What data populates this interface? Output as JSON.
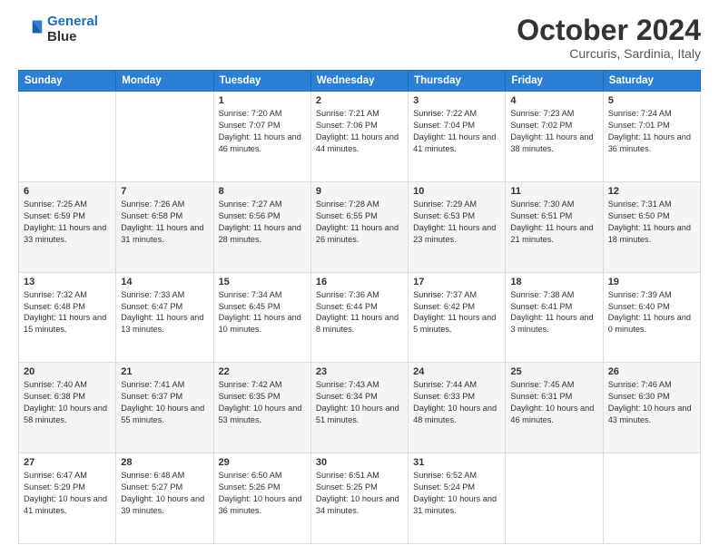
{
  "logo": {
    "line1": "General",
    "line2": "Blue"
  },
  "title": "October 2024",
  "subtitle": "Curcuris, Sardinia, Italy",
  "weekdays": [
    "Sunday",
    "Monday",
    "Tuesday",
    "Wednesday",
    "Thursday",
    "Friday",
    "Saturday"
  ],
  "weeks": [
    [
      {
        "day": "",
        "sunrise": "",
        "sunset": "",
        "daylight": ""
      },
      {
        "day": "",
        "sunrise": "",
        "sunset": "",
        "daylight": ""
      },
      {
        "day": "1",
        "sunrise": "Sunrise: 7:20 AM",
        "sunset": "Sunset: 7:07 PM",
        "daylight": "Daylight: 11 hours and 46 minutes."
      },
      {
        "day": "2",
        "sunrise": "Sunrise: 7:21 AM",
        "sunset": "Sunset: 7:06 PM",
        "daylight": "Daylight: 11 hours and 44 minutes."
      },
      {
        "day": "3",
        "sunrise": "Sunrise: 7:22 AM",
        "sunset": "Sunset: 7:04 PM",
        "daylight": "Daylight: 11 hours and 41 minutes."
      },
      {
        "day": "4",
        "sunrise": "Sunrise: 7:23 AM",
        "sunset": "Sunset: 7:02 PM",
        "daylight": "Daylight: 11 hours and 38 minutes."
      },
      {
        "day": "5",
        "sunrise": "Sunrise: 7:24 AM",
        "sunset": "Sunset: 7:01 PM",
        "daylight": "Daylight: 11 hours and 36 minutes."
      }
    ],
    [
      {
        "day": "6",
        "sunrise": "Sunrise: 7:25 AM",
        "sunset": "Sunset: 6:59 PM",
        "daylight": "Daylight: 11 hours and 33 minutes."
      },
      {
        "day": "7",
        "sunrise": "Sunrise: 7:26 AM",
        "sunset": "Sunset: 6:58 PM",
        "daylight": "Daylight: 11 hours and 31 minutes."
      },
      {
        "day": "8",
        "sunrise": "Sunrise: 7:27 AM",
        "sunset": "Sunset: 6:56 PM",
        "daylight": "Daylight: 11 hours and 28 minutes."
      },
      {
        "day": "9",
        "sunrise": "Sunrise: 7:28 AM",
        "sunset": "Sunset: 6:55 PM",
        "daylight": "Daylight: 11 hours and 26 minutes."
      },
      {
        "day": "10",
        "sunrise": "Sunrise: 7:29 AM",
        "sunset": "Sunset: 6:53 PM",
        "daylight": "Daylight: 11 hours and 23 minutes."
      },
      {
        "day": "11",
        "sunrise": "Sunrise: 7:30 AM",
        "sunset": "Sunset: 6:51 PM",
        "daylight": "Daylight: 11 hours and 21 minutes."
      },
      {
        "day": "12",
        "sunrise": "Sunrise: 7:31 AM",
        "sunset": "Sunset: 6:50 PM",
        "daylight": "Daylight: 11 hours and 18 minutes."
      }
    ],
    [
      {
        "day": "13",
        "sunrise": "Sunrise: 7:32 AM",
        "sunset": "Sunset: 6:48 PM",
        "daylight": "Daylight: 11 hours and 15 minutes."
      },
      {
        "day": "14",
        "sunrise": "Sunrise: 7:33 AM",
        "sunset": "Sunset: 6:47 PM",
        "daylight": "Daylight: 11 hours and 13 minutes."
      },
      {
        "day": "15",
        "sunrise": "Sunrise: 7:34 AM",
        "sunset": "Sunset: 6:45 PM",
        "daylight": "Daylight: 11 hours and 10 minutes."
      },
      {
        "day": "16",
        "sunrise": "Sunrise: 7:36 AM",
        "sunset": "Sunset: 6:44 PM",
        "daylight": "Daylight: 11 hours and 8 minutes."
      },
      {
        "day": "17",
        "sunrise": "Sunrise: 7:37 AM",
        "sunset": "Sunset: 6:42 PM",
        "daylight": "Daylight: 11 hours and 5 minutes."
      },
      {
        "day": "18",
        "sunrise": "Sunrise: 7:38 AM",
        "sunset": "Sunset: 6:41 PM",
        "daylight": "Daylight: 11 hours and 3 minutes."
      },
      {
        "day": "19",
        "sunrise": "Sunrise: 7:39 AM",
        "sunset": "Sunset: 6:40 PM",
        "daylight": "Daylight: 11 hours and 0 minutes."
      }
    ],
    [
      {
        "day": "20",
        "sunrise": "Sunrise: 7:40 AM",
        "sunset": "Sunset: 6:38 PM",
        "daylight": "Daylight: 10 hours and 58 minutes."
      },
      {
        "day": "21",
        "sunrise": "Sunrise: 7:41 AM",
        "sunset": "Sunset: 6:37 PM",
        "daylight": "Daylight: 10 hours and 55 minutes."
      },
      {
        "day": "22",
        "sunrise": "Sunrise: 7:42 AM",
        "sunset": "Sunset: 6:35 PM",
        "daylight": "Daylight: 10 hours and 53 minutes."
      },
      {
        "day": "23",
        "sunrise": "Sunrise: 7:43 AM",
        "sunset": "Sunset: 6:34 PM",
        "daylight": "Daylight: 10 hours and 51 minutes."
      },
      {
        "day": "24",
        "sunrise": "Sunrise: 7:44 AM",
        "sunset": "Sunset: 6:33 PM",
        "daylight": "Daylight: 10 hours and 48 minutes."
      },
      {
        "day": "25",
        "sunrise": "Sunrise: 7:45 AM",
        "sunset": "Sunset: 6:31 PM",
        "daylight": "Daylight: 10 hours and 46 minutes."
      },
      {
        "day": "26",
        "sunrise": "Sunrise: 7:46 AM",
        "sunset": "Sunset: 6:30 PM",
        "daylight": "Daylight: 10 hours and 43 minutes."
      }
    ],
    [
      {
        "day": "27",
        "sunrise": "Sunrise: 6:47 AM",
        "sunset": "Sunset: 5:29 PM",
        "daylight": "Daylight: 10 hours and 41 minutes."
      },
      {
        "day": "28",
        "sunrise": "Sunrise: 6:48 AM",
        "sunset": "Sunset: 5:27 PM",
        "daylight": "Daylight: 10 hours and 39 minutes."
      },
      {
        "day": "29",
        "sunrise": "Sunrise: 6:50 AM",
        "sunset": "Sunset: 5:26 PM",
        "daylight": "Daylight: 10 hours and 36 minutes."
      },
      {
        "day": "30",
        "sunrise": "Sunrise: 6:51 AM",
        "sunset": "Sunset: 5:25 PM",
        "daylight": "Daylight: 10 hours and 34 minutes."
      },
      {
        "day": "31",
        "sunrise": "Sunrise: 6:52 AM",
        "sunset": "Sunset: 5:24 PM",
        "daylight": "Daylight: 10 hours and 31 minutes."
      },
      {
        "day": "",
        "sunrise": "",
        "sunset": "",
        "daylight": ""
      },
      {
        "day": "",
        "sunrise": "",
        "sunset": "",
        "daylight": ""
      }
    ]
  ]
}
